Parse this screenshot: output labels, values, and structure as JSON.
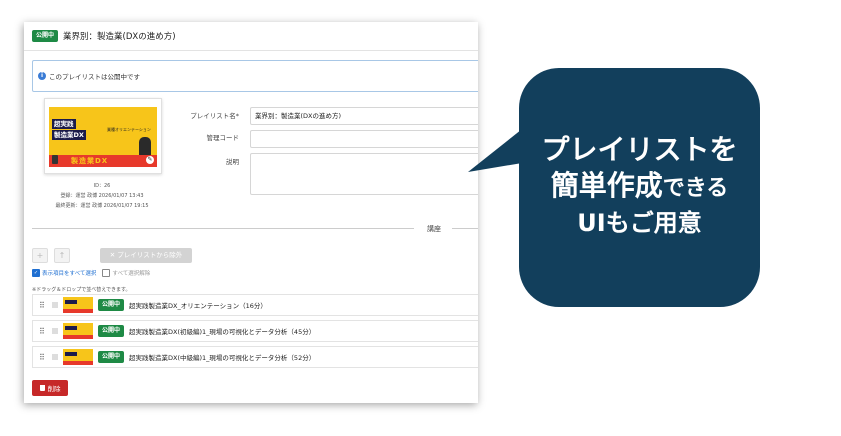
{
  "header": {
    "status_badge": "公開中",
    "title": "業界別：製造業(DXの進め方)"
  },
  "notice": {
    "icon": "info-icon",
    "text": "このプレイリストは公開中です"
  },
  "thumbnail": {
    "line1": "超実践",
    "line2": "製造業DX",
    "subtitle": "業種オリエンテーション",
    "banner": "製造業DX"
  },
  "meta": {
    "id": "ID：26",
    "registered": "登録：運営 政博 2026/01/07 13:43",
    "updated": "最終更新：運営 政博 2026/01/07 19:15"
  },
  "form": {
    "name_label": "プレイリスト名*",
    "name_value": "業界別：製造業(DXの進め方)",
    "code_label": "管理コード",
    "code_value": "",
    "desc_label": "説明",
    "desc_value": ""
  },
  "section": {
    "title": "講座"
  },
  "toolbar": {
    "add_label": "+",
    "up_label": "↑",
    "remove_label": "✕ プレイリストから除外",
    "select_all_label": "表示項目をすべて選択",
    "deselect_all_label": "すべて選択解除"
  },
  "drag_note": "※ドラッグ＆ドロップで並べ替えできます。",
  "courses": [
    {
      "badge": "公開中",
      "title": "超実践製造業DX_オリエンテーション（16分）"
    },
    {
      "badge": "公開中",
      "title": "超実践製造業DX(初級編)1_現場の可視化とデータ分析（45分）"
    },
    {
      "badge": "公開中",
      "title": "超実践製造業DX(中級編)1_現場の可視化とデータ分析（52分）"
    }
  ],
  "delete_label": "削除",
  "callout": {
    "line1": "プレイリストを",
    "line2_big": "簡単作成",
    "line2_small": "できる",
    "line3": "UIもご用意",
    "color": "#123f5c"
  },
  "colors": {
    "badge_green": "#1e8a45",
    "delete_red": "#c62828",
    "info_blue": "#3a7bd5"
  }
}
